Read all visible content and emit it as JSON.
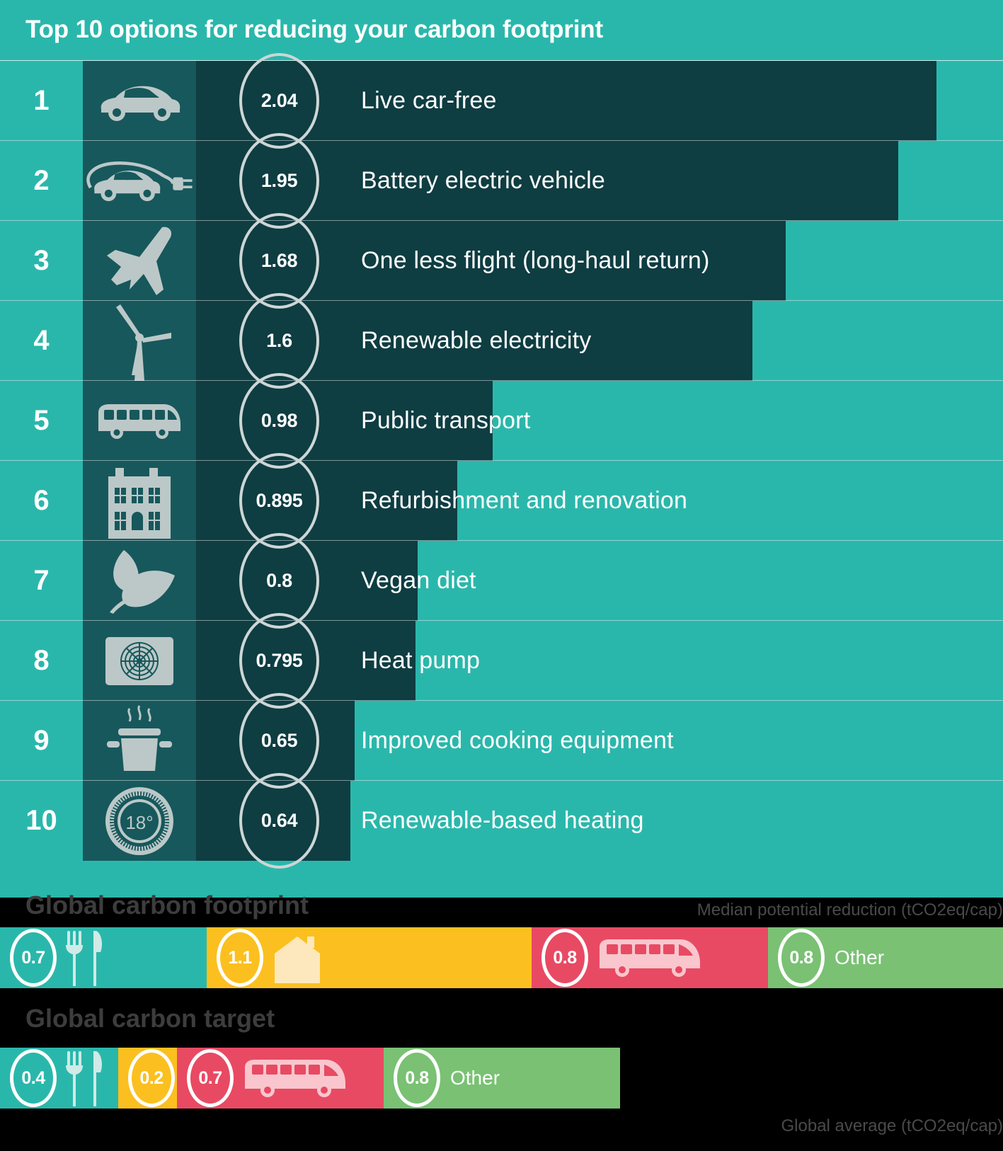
{
  "chart_data": {
    "type": "bar",
    "title": "Top 10 options for reducing your carbon footprint",
    "xlabel": "Median potential reduction (tCO2eq/cap)",
    "ylabel": "",
    "xlim": [
      0,
      2.2
    ],
    "grid": false,
    "legend": "none",
    "categories": [
      "Live car-free",
      "Battery electric vehicle",
      "One less flight (long-haul return)",
      "Renewable electricity",
      "Public transport",
      "Refurbishment and renovation",
      "Vegan diet",
      "Heat pump",
      "Improved cooking equipment",
      "Renewable-based heating"
    ],
    "values": [
      2.04,
      1.95,
      1.68,
      1.6,
      0.98,
      0.895,
      0.8,
      0.795,
      0.65,
      0.64
    ],
    "ranks": [
      1,
      2,
      3,
      4,
      5,
      6,
      7,
      8,
      9,
      10
    ],
    "icons": [
      "car-icon",
      "electric-car-icon",
      "airplane-icon",
      "wind-turbine-icon",
      "bus-icon",
      "building-icon",
      "leaf-icon",
      "heat-pump-icon",
      "cooking-pot-icon",
      "thermostat-icon"
    ],
    "secondary_charts": [
      {
        "type": "bar",
        "orientation": "stacked-horizontal",
        "title": "Global carbon footprint",
        "xlabel": "Global average (tCO2eq/cap)",
        "segments": [
          {
            "label": "food",
            "value": 0.7,
            "color": "#2ab7ab",
            "icon": "cutlery-icon",
            "text": ""
          },
          {
            "label": "housing",
            "value": 1.1,
            "color": "#fbc01f",
            "icon": "house-icon",
            "text": ""
          },
          {
            "label": "transport",
            "value": 0.8,
            "color": "#e84a63",
            "icon": "bus-icon",
            "text": ""
          },
          {
            "label": "other",
            "value": 0.8,
            "color": "#7ac174",
            "icon": "",
            "text": "Other"
          }
        ],
        "total": 3.4
      },
      {
        "type": "bar",
        "orientation": "stacked-horizontal",
        "title": "Global carbon target",
        "xlabel": "Global average (tCO2eq/cap)",
        "segments": [
          {
            "label": "food",
            "value": 0.4,
            "color": "#2ab7ab",
            "icon": "cutlery-icon",
            "text": ""
          },
          {
            "label": "housing",
            "value": 0.2,
            "color": "#fbc01f",
            "icon": "house-icon",
            "text": ""
          },
          {
            "label": "transport",
            "value": 0.7,
            "color": "#e84a63",
            "icon": "bus-icon",
            "text": ""
          },
          {
            "label": "other",
            "value": 0.8,
            "color": "#7ac174",
            "icon": "",
            "text": "Other"
          }
        ],
        "total": 2.1
      }
    ]
  },
  "chart": {
    "title": "Top 10 options for reducing your carbon footprint",
    "caption_median": "Median potential reduction (tCO2eq/cap)",
    "rows": [
      {
        "rank": "1",
        "value": "2.04",
        "label": "Live car-free"
      },
      {
        "rank": "2",
        "value": "1.95",
        "label": "Battery electric vehicle"
      },
      {
        "rank": "3",
        "value": "1.68",
        "label": "One less flight (long-haul return)"
      },
      {
        "rank": "4",
        "value": "1.6",
        "label": "Renewable electricity"
      },
      {
        "rank": "5",
        "value": "0.98",
        "label": "Public transport"
      },
      {
        "rank": "6",
        "value": "0.895",
        "label": "Refurbishment and renovation"
      },
      {
        "rank": "7",
        "value": "0.8",
        "label": "Vegan diet"
      },
      {
        "rank": "8",
        "value": "0.795",
        "label": "Heat pump"
      },
      {
        "rank": "9",
        "value": "0.65",
        "label": "Improved cooking equipment"
      },
      {
        "rank": "10",
        "value": "0.64",
        "label": "Renewable-based heating"
      }
    ]
  },
  "footprint": {
    "title": "Global carbon footprint",
    "segments": [
      {
        "value": "0.7",
        "text": ""
      },
      {
        "value": "1.1",
        "text": ""
      },
      {
        "value": "0.8",
        "text": ""
      },
      {
        "value": "0.8",
        "text": "Other"
      }
    ]
  },
  "target": {
    "title": "Global carbon target",
    "caption_average": "Global average (tCO2eq/cap)",
    "segments": [
      {
        "value": "0.4",
        "text": ""
      },
      {
        "value": "0.2",
        "text": ""
      },
      {
        "value": "0.7",
        "text": ""
      },
      {
        "value": "0.8",
        "text": "Other"
      }
    ]
  },
  "colors": {
    "brand_teal": "#2ab7ab",
    "bar_dark": "#0e3d42",
    "icon_cell": "#17585c",
    "yellow": "#fbc01f",
    "pink": "#e84a63",
    "green": "#7ac174",
    "black": "#000000"
  }
}
